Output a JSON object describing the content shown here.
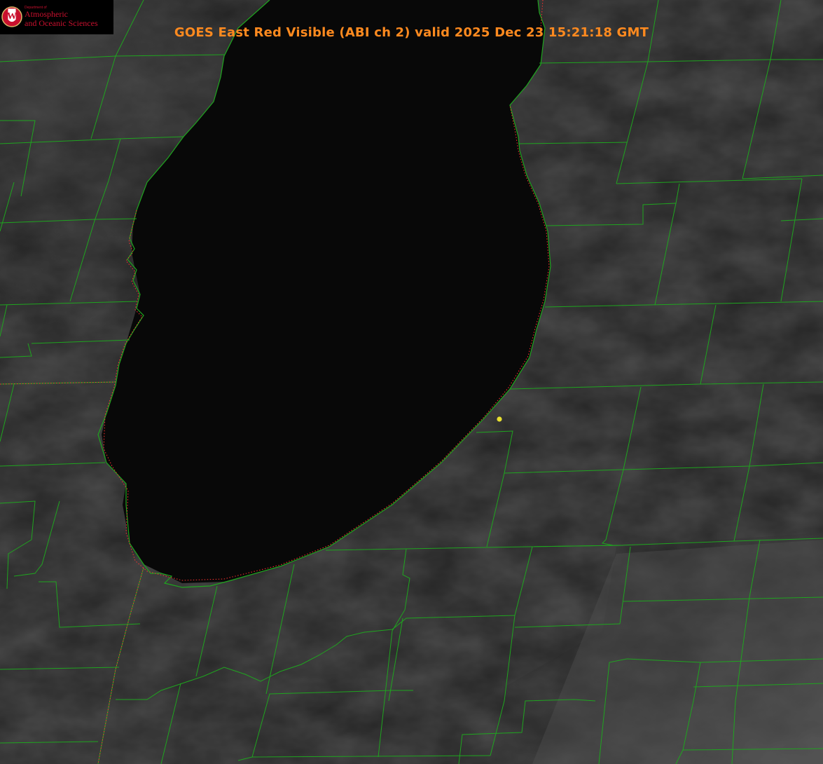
{
  "title": "GOES East Red Visible (ABI ch 2) valid 2025 Dec 23 15:21:18 GMT",
  "logo": {
    "line1": "Department of",
    "line2": "Atmospheric",
    "line3": "and Oceanic Sciences",
    "seal_letter": "W"
  },
  "colors": {
    "title": "#ff8a1f",
    "county_lines": "#1fa51f",
    "state_lines": "#ff3030",
    "marker": "#e8e030",
    "lake": "#080808",
    "land": "#202020",
    "logo_text": "#c8102e"
  },
  "icons": {
    "seal": "uw-crest-icon",
    "station_marker": "dot-marker-icon"
  }
}
